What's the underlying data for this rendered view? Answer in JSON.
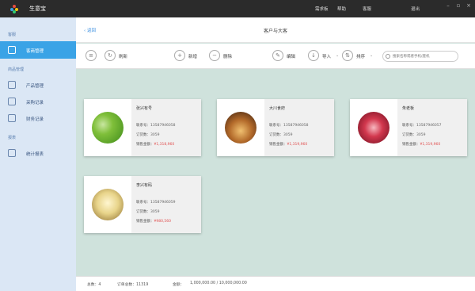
{
  "app": {
    "title": "生意宝"
  },
  "top_menu": [
    "需求板",
    "帮助",
    "客服",
    "退出"
  ],
  "sidebar": {
    "sections": [
      {
        "title": "客服",
        "items": [
          {
            "label": "客商管理",
            "active": true
          }
        ]
      },
      {
        "title": "商品管理",
        "items": [
          {
            "label": "产品管理"
          },
          {
            "label": "采购记录"
          },
          {
            "label": "财务记录"
          }
        ]
      },
      {
        "title": "报表",
        "items": [
          {
            "label": "统计报表"
          }
        ]
      }
    ]
  },
  "header": {
    "back": "返回",
    "title": "客户与大客"
  },
  "toolbar": {
    "refresh": "刷新",
    "add": "新增",
    "delete": "删除",
    "edit": "编辑",
    "import": "导入",
    "sort": "排序",
    "search_placeholder": "搜索名称或者手机/座机"
  },
  "card_labels": {
    "phone": "联系号：",
    "orders": "订货数：",
    "amount": "销售金额："
  },
  "cards": [
    {
      "name": "张兴有号",
      "phone": "13587946058",
      "orders": "3059",
      "amount": "¥1,318,960",
      "avatar_color": "#5aa62a"
    },
    {
      "name": "大川食府",
      "phone": "13587946058",
      "orders": "3059",
      "amount": "¥1,319,960",
      "avatar_color": "#a0662a"
    },
    {
      "name": "朱老板",
      "phone": "13587946057",
      "orders": "3059",
      "amount": "¥1,319,960",
      "avatar_color": "#c8324a"
    },
    {
      "name": "李兴有码",
      "phone": "13587946059",
      "orders": "3059",
      "amount": "¥980,560",
      "avatar_color": "#d6c27a"
    }
  ],
  "status": {
    "total": "总数：4",
    "order_total": "订单总数：11319",
    "amount": "金额：",
    "amount_value": "1,000,000.00 / 10,000,000.00"
  },
  "colors": {
    "accent": "#3aa3e6",
    "titlebar": "#2b2b2b",
    "canvas": "#cfe2dc",
    "red_value": "#e05050"
  }
}
